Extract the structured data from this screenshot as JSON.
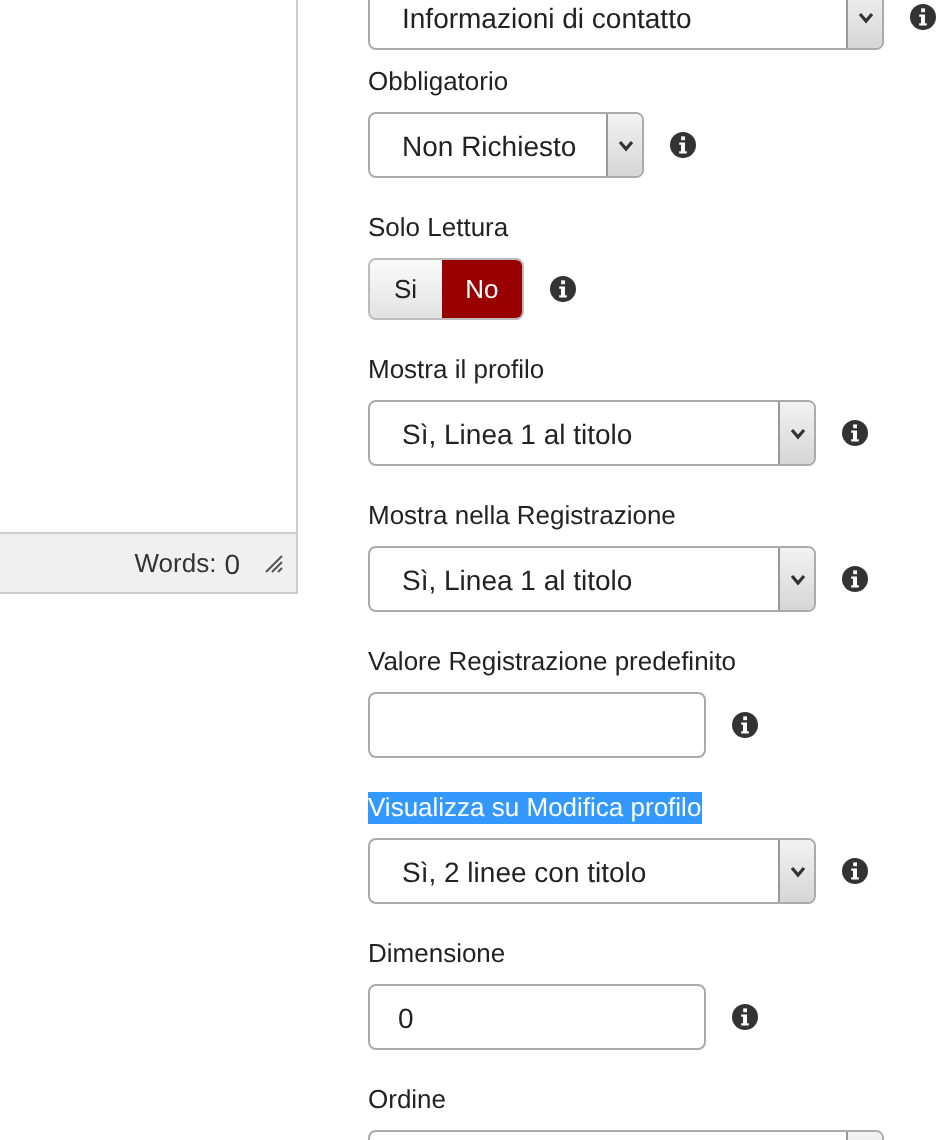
{
  "editor": {
    "words_label": "Words:",
    "words_count": "0"
  },
  "fields": [
    {
      "kind": "wide-select",
      "value": "Informazioni di contatto",
      "info": true
    },
    {
      "label": "Obbligatorio",
      "kind": "compact-select",
      "value": "Non Richiesto",
      "info": true
    },
    {
      "label": "Solo Lettura",
      "kind": "toggle",
      "options": [
        {
          "label": "Si",
          "selected": false
        },
        {
          "label": "No",
          "selected": true
        }
      ],
      "info": true
    },
    {
      "label": "Mostra il profilo",
      "kind": "select",
      "value": "Sì, Linea 1 al titolo",
      "info": true
    },
    {
      "label": "Mostra nella Registrazione",
      "kind": "select",
      "value": "Sì, Linea 1 al titolo",
      "info": true
    },
    {
      "label": "Valore Registrazione predefinito",
      "kind": "text",
      "info": true
    },
    {
      "label": "Visualizza su Modifica profilo",
      "kind": "select",
      "value": "Sì, 2 linee con titolo",
      "info": true,
      "highlighted": true
    },
    {
      "label": "Dimensione",
      "kind": "text",
      "value": "0",
      "info": true
    },
    {
      "label": "Ordine",
      "kind": "wide-select"
    }
  ]
}
